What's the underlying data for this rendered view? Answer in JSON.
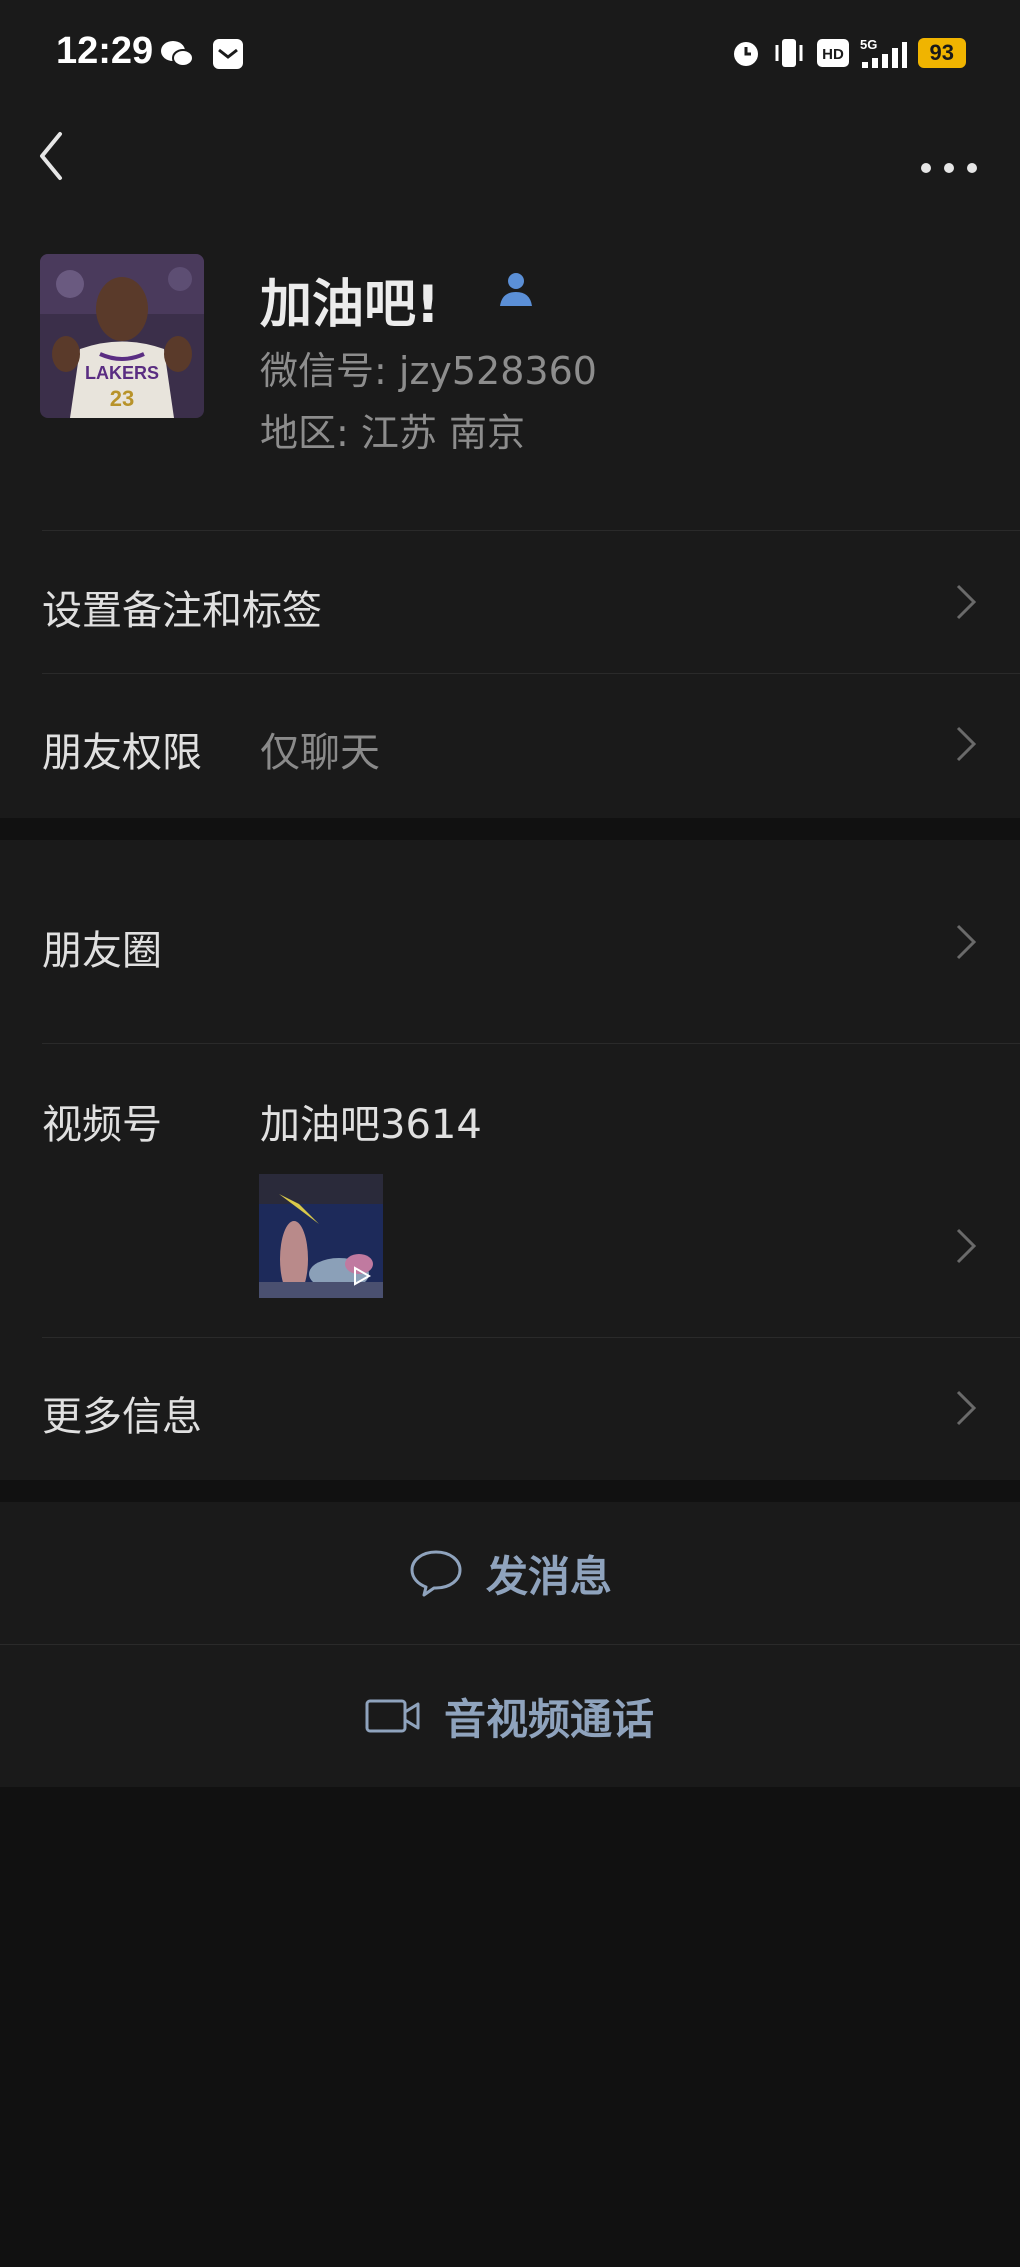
{
  "status_bar": {
    "time": "12:29",
    "battery": "93"
  },
  "profile": {
    "nickname": "加油吧!",
    "wechat_id": "微信号: jzy528360",
    "region": "地区: 江苏  南京"
  },
  "settings": {
    "remark_label": "设置备注和标签",
    "permission_label": "朋友权限",
    "permission_value": "仅聊天"
  },
  "social": {
    "moments_label": "朋友圈",
    "channels_label": "视频号",
    "channels_name": "加油吧3614",
    "more_info_label": "更多信息"
  },
  "actions": {
    "message_label": "发消息",
    "call_label": "音视频通话"
  },
  "colors": {
    "accent_blue": "#5b8fd6",
    "action_text": "#8fa3bd",
    "battery": "#f0b400"
  }
}
